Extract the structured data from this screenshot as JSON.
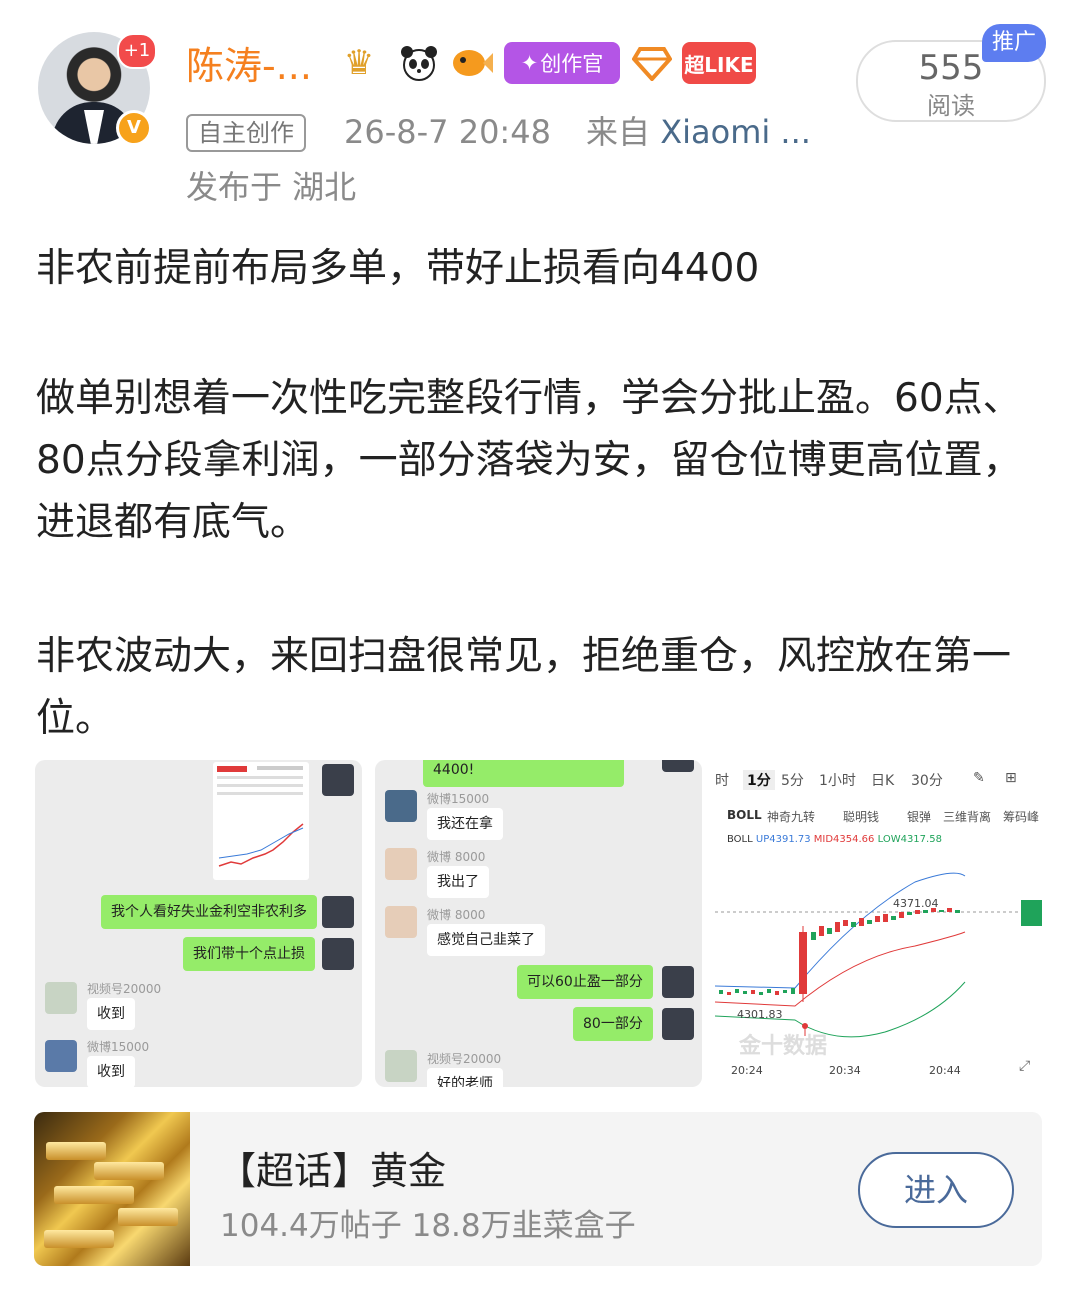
{
  "header": {
    "author_name": "陈涛-...",
    "plus_badge": "+1",
    "verified_badge": "V",
    "creator_badge": "创作官",
    "superlike_badge": "超LIKE",
    "tag": "自主创作",
    "time": "26-8-7 20:48",
    "source_prefix": "来自",
    "source_device": "Xiaomi ...",
    "location": "发布于 湖北",
    "read_count": "555",
    "read_label": "阅读",
    "promo_label": "推广"
  },
  "post": {
    "p1": "非农前提前布局多单，带好止损看向4400",
    "p2": "做单别想着一次性吃完整段行情，学会分批止盈。60点、80点分段拿利润，一部分落袋为安，留仓位博更高位置，进退都有底气。",
    "p3": "非农波动大，来回扫盘很常见，拒绝重仓，风控放在第一位。"
  },
  "image1": {
    "msg1": "我个人看好失业金利空非农利多",
    "msg2": "我们带十个点止损",
    "user1": "视频号20000",
    "reply1": "收到",
    "user2": "微博15000",
    "reply2": "收到"
  },
  "image2": {
    "top_msg": "4400!",
    "user1": "微博15000",
    "reply1": "我还在拿",
    "user2": "微博 8000",
    "reply2": "我出了",
    "user3": "微博 8000",
    "reply3": "感觉自己韭菜了",
    "msg1": "可以60止盈一部分",
    "msg2": "80一部分",
    "user4": "视频号20000",
    "reply4": "好的老师"
  },
  "image3": {
    "tabs": [
      "时",
      "1分",
      "5分",
      "1小时",
      "日K",
      "30分"
    ],
    "indicators": [
      "BOLL",
      "神奇九转",
      "聪明钱",
      "银弹",
      "三维背离",
      "筹码峰"
    ],
    "boll_label": "BOLL",
    "boll_up": "UP4391.73",
    "boll_mid": "MID4354.66",
    "boll_low": "LOW4317.58",
    "high_label": "4371.04",
    "low_label": "4301.83",
    "x_ticks": [
      "20:24",
      "20:34",
      "20:44"
    ],
    "watermark": "金十数据",
    "colors": {
      "up": "#e03a3a",
      "down": "#1fa35a",
      "boll": "#3a7ad8"
    }
  },
  "topic": {
    "title": "【超话】黄金",
    "stats": "104.4万帖子 18.8万韭菜盒子",
    "enter_label": "进入"
  }
}
